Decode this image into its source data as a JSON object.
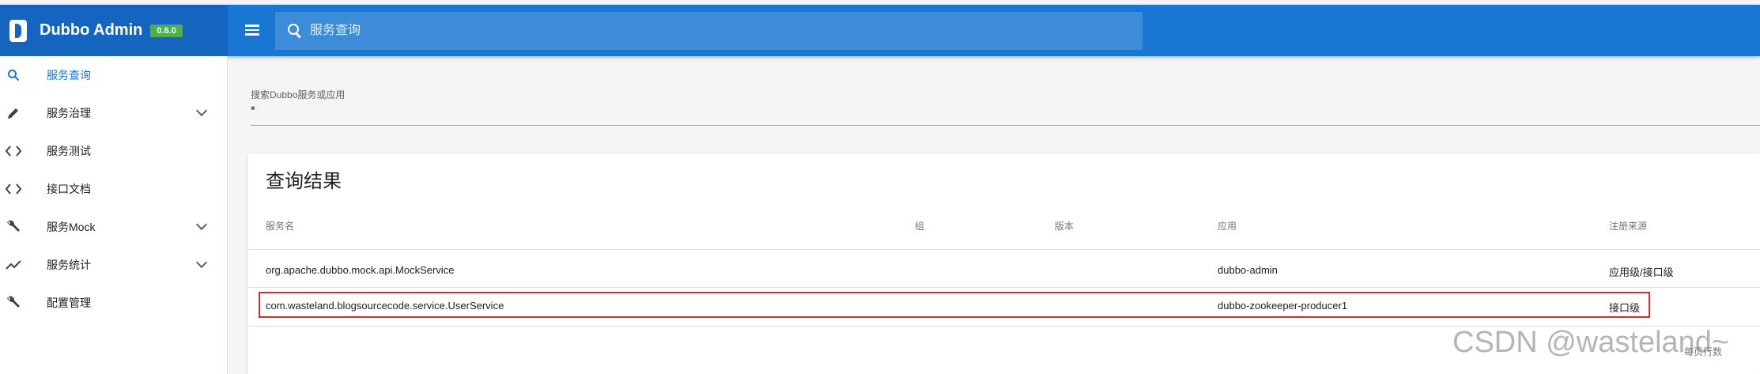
{
  "header": {
    "brand": "Dubbo Admin",
    "version": "0.6.0",
    "search_placeholder": "服务查询"
  },
  "sidebar": {
    "items": [
      {
        "label": "服务查询",
        "icon": "search-icon",
        "active": true,
        "expandable": false
      },
      {
        "label": "服务治理",
        "icon": "pencil-icon",
        "active": false,
        "expandable": true
      },
      {
        "label": "服务测试",
        "icon": "code-icon",
        "active": false,
        "expandable": false
      },
      {
        "label": "接口文档",
        "icon": "code-icon",
        "active": false,
        "expandable": false
      },
      {
        "label": "服务Mock",
        "icon": "wrench-icon",
        "active": false,
        "expandable": true
      },
      {
        "label": "服务统计",
        "icon": "trend-icon",
        "active": false,
        "expandable": true
      },
      {
        "label": "配置管理",
        "icon": "wrench-icon",
        "active": false,
        "expandable": false
      }
    ]
  },
  "search_field": {
    "label": "搜索Dubbo服务或应用",
    "value": "*"
  },
  "results": {
    "title": "查询结果",
    "columns": [
      "服务名",
      "组",
      "版本",
      "应用",
      "注册来源"
    ],
    "rows": [
      {
        "service": "org.apache.dubbo.mock.api.MockService",
        "group": "",
        "version": "",
        "app": "dubbo-admin",
        "source": "应用级/接口级"
      },
      {
        "service": "com.wasteland.blogsourcecode.service.UserService",
        "group": "",
        "version": "",
        "app": "dubbo-zookeeper-producer1",
        "source": "接口级"
      }
    ],
    "pager_text": "每页行数"
  },
  "watermark": "CSDN @wasteland~",
  "colors": {
    "primary": "#1976d2",
    "brand_bg": "#1565c0",
    "version_badge": "#4caf50",
    "highlight": "#d32f2f"
  }
}
